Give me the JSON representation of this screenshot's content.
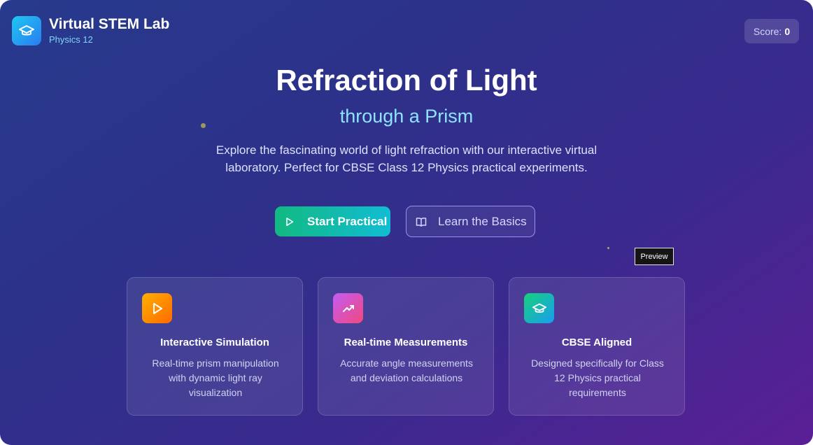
{
  "header": {
    "app_title": "Virtual STEM Lab",
    "app_subtitle": "Physics 12",
    "score_label": "Score:",
    "score_value": "0"
  },
  "hero": {
    "title": "Refraction of Light",
    "subtitle": "through a Prism",
    "description": "Explore the fascinating world of light refraction with our interactive virtual laboratory. Perfect for CBSE Class 12 Physics practical experiments."
  },
  "actions": {
    "start_label": "Start Practical",
    "learn_label": "Learn the Basics"
  },
  "tooltip": {
    "text": "Preview"
  },
  "features": [
    {
      "icon": "play-icon",
      "title": "Interactive Simulation",
      "description": "Real-time prism manipulation with dynamic light ray visualization"
    },
    {
      "icon": "trending-up-icon",
      "title": "Real-time Measurements",
      "description": "Accurate angle measurements and deviation calculations"
    },
    {
      "icon": "graduation-cap-icon",
      "title": "CBSE Aligned",
      "description": "Designed specifically for Class 12 Physics practical requirements"
    }
  ],
  "colors": {
    "background_start": "#273a8c",
    "background_end": "#5a1f95",
    "accent_cyan": "#8fe3ff",
    "start_button": "#12b981",
    "learn_border": "#9b8ff0"
  }
}
